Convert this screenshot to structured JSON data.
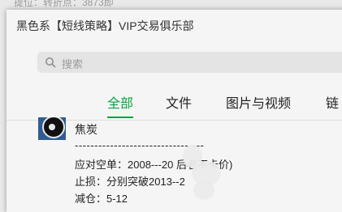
{
  "background_window": {
    "text": "提位：转折点：3873即"
  },
  "window": {
    "title": "黑色系【短线策略】VIP交易俱乐部"
  },
  "search": {
    "placeholder": "搜索",
    "icon": "search-icon"
  },
  "tabs": [
    {
      "label": "全部",
      "active": true
    },
    {
      "label": "文件",
      "active": false
    },
    {
      "label": "图片与视频",
      "active": false
    },
    {
      "label": "链",
      "active": false
    }
  ],
  "message": {
    "sender": "焦炭",
    "separator": "---------------------------------",
    "lines": [
      "应对空单：2008---20  后者不卡价)",
      "止损：分别突破2013--2",
      "减仓：5-12"
    ]
  },
  "colors": {
    "accent": "#07a340",
    "avatar_bg": "#2f5c92"
  }
}
